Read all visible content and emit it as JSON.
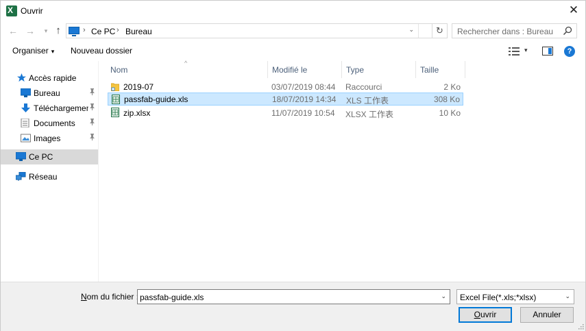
{
  "window": {
    "title": "Ouvrir",
    "close_glyph": "✕"
  },
  "nav": {
    "back_glyph": "←",
    "forward_glyph": "→",
    "recent_glyph": "▾",
    "up_glyph": "↑",
    "breadcrumb": [
      "Ce PC",
      "Bureau"
    ],
    "crumb_separator": "›",
    "dropdown_glyph": "⌄",
    "refresh_glyph": "↻",
    "search_placeholder": "Rechercher dans : Bureau"
  },
  "toolbar": {
    "organize_label": "Organiser",
    "organize_caret": "▾",
    "new_folder_label": "Nouveau dossier",
    "view_caret": "▾",
    "help_glyph": "?"
  },
  "sidebar": {
    "items": [
      {
        "label": "Accès rapide",
        "icon": "star-icon",
        "pinned": false,
        "selected": false
      },
      {
        "label": "Bureau",
        "icon": "desktop-icon",
        "pinned": true,
        "selected": false
      },
      {
        "label": "Téléchargements",
        "icon": "download-icon",
        "pinned": true,
        "selected": false
      },
      {
        "label": "Documents",
        "icon": "documents-icon",
        "pinned": true,
        "selected": false
      },
      {
        "label": "Images",
        "icon": "images-icon",
        "pinned": true,
        "selected": false
      },
      {
        "label": "Ce PC",
        "icon": "computer-icon",
        "pinned": false,
        "selected": true
      },
      {
        "label": "Réseau",
        "icon": "network-icon",
        "pinned": false,
        "selected": false
      }
    ],
    "pin_glyph": "📌"
  },
  "columns": {
    "name": "Nom",
    "modified": "Modifié le",
    "type": "Type",
    "size": "Taille",
    "sort_glyph": "^"
  },
  "files": [
    {
      "name": "2019-07",
      "modified": "03/07/2019 08:44",
      "type": "Raccourci",
      "size": "2 Ko",
      "icon": "shortcut-folder-icon",
      "selected": false
    },
    {
      "name": "passfab-guide.xls",
      "modified": "18/07/2019 14:34",
      "type": "XLS 工作表",
      "size": "308 Ko",
      "icon": "excel-file-icon",
      "selected": true
    },
    {
      "name": "zip.xlsx",
      "modified": "11/07/2019 10:54",
      "type": "XLSX 工作表",
      "size": "10 Ko",
      "icon": "excel-file-icon",
      "selected": false
    }
  ],
  "footer": {
    "filename_label_prefix": "N",
    "filename_label_rest": "om du fichier :",
    "filename_value": "passfab-guide.xls",
    "filter_value": "Excel File(*.xls;*xlsx)",
    "dropdown_glyph": "⌄",
    "open_label_prefix": "O",
    "open_label_rest": "uvrir",
    "cancel_label": "Annuler"
  },
  "colors": {
    "selection_fill": "#cce8ff",
    "selection_border": "#99d1ff",
    "accent": "#0078d7",
    "header_text": "#4c607a"
  }
}
